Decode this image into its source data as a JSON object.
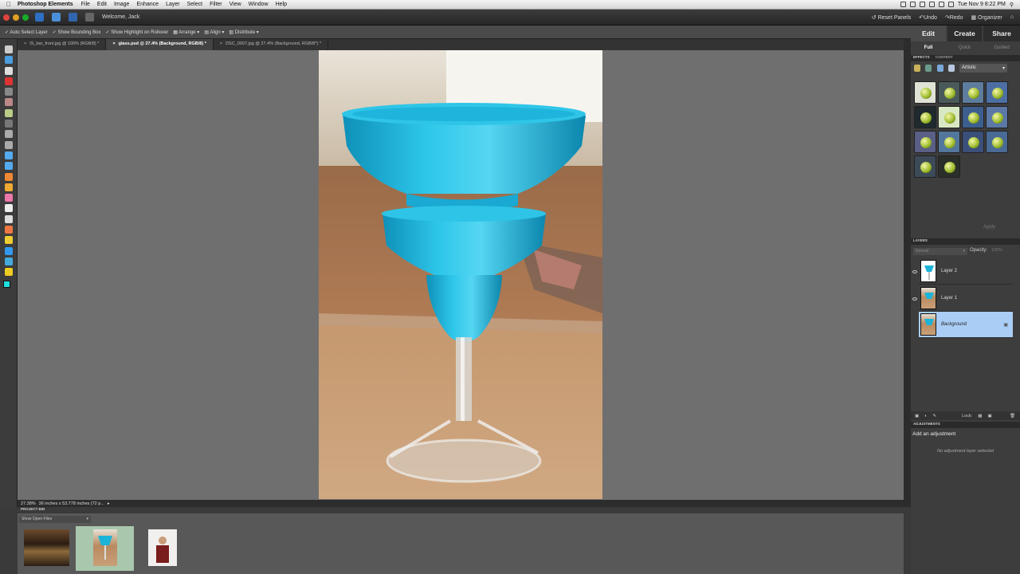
{
  "menubar": {
    "app_name": "Photoshop Elements",
    "items": [
      "File",
      "Edit",
      "Image",
      "Enhance",
      "Layer",
      "Select",
      "Filter",
      "View",
      "Window",
      "Help"
    ],
    "clock": "Tue Nov 9  8:22 PM"
  },
  "appbar": {
    "welcome": "Welcome, Jack",
    "reset_panels": "Reset Panels",
    "undo": "Undo",
    "redo": "Redo",
    "organizer": "Organizer"
  },
  "options": {
    "auto_select": "Auto Select Layer",
    "bounding_box": "Show Bounding Box",
    "highlight": "Show Highlight on Rollover",
    "arrange": "Arrange",
    "align": "Align",
    "distribute": "Distribute"
  },
  "tabs": [
    {
      "label": "IS_bar_front.jpg @ 100% (RGB/8) *"
    },
    {
      "label": "glass.psd @ 27.4% (Background, RGB/8) *"
    },
    {
      "label": "DSC_0007.jpg @ 27.4% (Background, RGB/8*) *"
    }
  ],
  "status": {
    "zoom": "27.38%",
    "doc_info": "36 inches x 53.778 inches (72 p..."
  },
  "project_bin": {
    "title": "PROJECT BIN",
    "dropdown": "Show Open Files"
  },
  "panel": {
    "main_tabs": [
      "Edit",
      "Create",
      "Share"
    ],
    "sub_tabs": [
      "Full",
      "Quick",
      "Guided"
    ],
    "effects_tab": "EFFECTS",
    "content_tab": "CONTENT",
    "category": "Artistic",
    "apply": "Apply",
    "layers_title": "LAYERS",
    "blend_mode": "Normal",
    "opacity_label": "Opacity:",
    "opacity_value": "100%",
    "lock_label": "Lock:",
    "layers": [
      {
        "name": "Layer 2"
      },
      {
        "name": "Layer 1"
      },
      {
        "name": "Background"
      }
    ],
    "adjustments_title": "ADJUSTMENTS",
    "add_adjustment": "Add an adjustment",
    "no_adjustment": "No adjustment layer selected"
  },
  "colors": {
    "accent_selected": "#a9cdf5",
    "glass_blue": "#1ab4d8"
  }
}
